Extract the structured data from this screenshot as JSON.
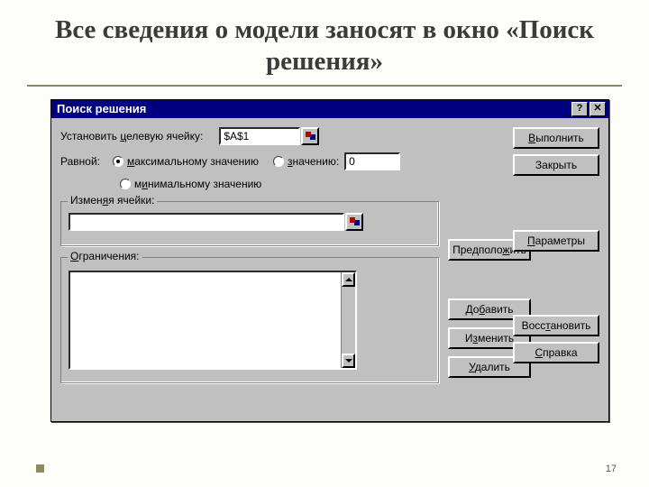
{
  "slide": {
    "title": "Все сведения о модели заносят в окно «Поиск решения»",
    "number": "17"
  },
  "dialog": {
    "title": "Поиск решения",
    "help_btn": "?",
    "close_btn": "✕",
    "target_label_pre": "Установить ",
    "target_label_u": "ц",
    "target_label_post": "елевую ячейку:",
    "target_value": "$A$1",
    "equal_label": "Равной:",
    "radio_max_u": "м",
    "radio_max_post": "аксимальному значению",
    "radio_val_u": "з",
    "radio_val_post": "начению:",
    "value_input": "0",
    "radio_min_pre": "м",
    "radio_min_u": "и",
    "radio_min_post": "нимальному значению",
    "changing_legend_pre": "Измен",
    "changing_legend_u": "я",
    "changing_legend_post": "я ячейки:",
    "constraints_legend_u": "О",
    "constraints_legend_post": "граничения:",
    "btn_suggest_pre": "Предполо",
    "btn_suggest_u": "ж",
    "btn_suggest_post": "ить",
    "btn_add_pre": "До",
    "btn_add_u": "б",
    "btn_add_post": "авить",
    "btn_edit_pre": "И",
    "btn_edit_u": "з",
    "btn_edit_post": "менить",
    "btn_delete_u": "У",
    "btn_delete_post": "далить",
    "btn_execute_u": "В",
    "btn_execute_post": "ыполнить",
    "btn_close": "Закрыть",
    "btn_params_u": "П",
    "btn_params_post": "араметры",
    "btn_restore_pre": "Восс",
    "btn_restore_u": "т",
    "btn_restore_post": "ановить",
    "btn_help_u": "С",
    "btn_help_post": "правка"
  }
}
